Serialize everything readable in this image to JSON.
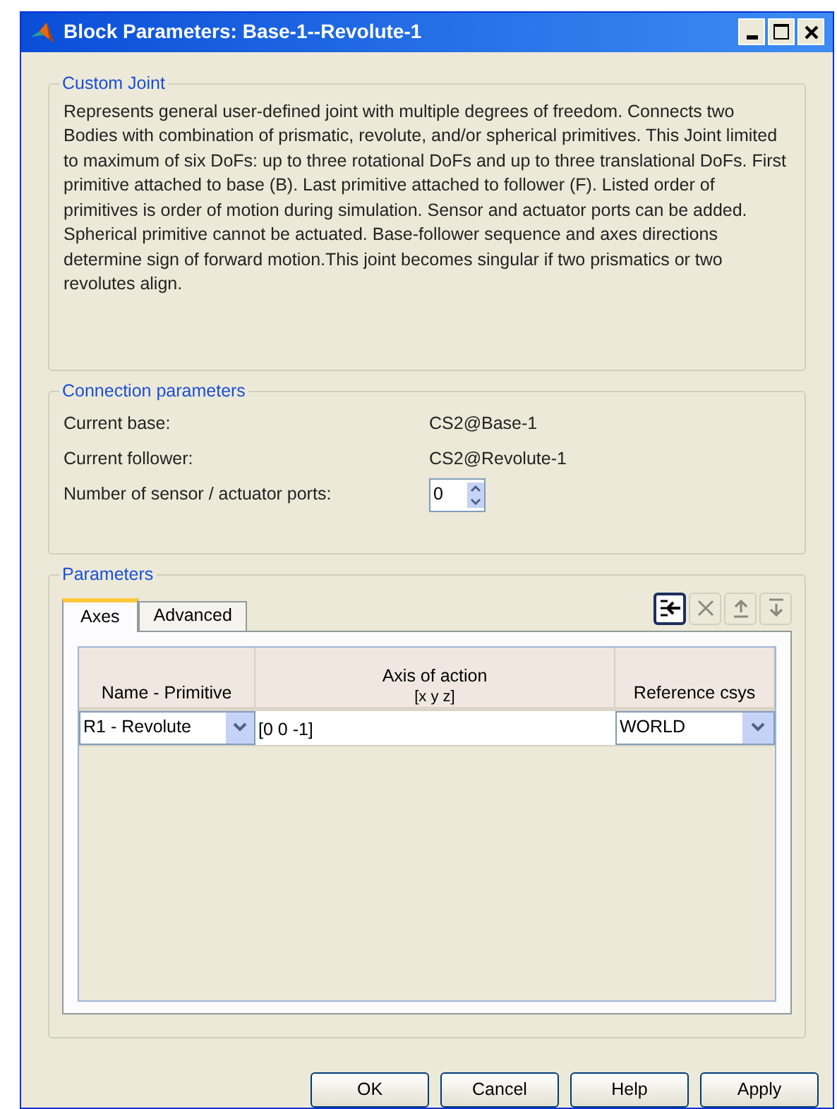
{
  "window": {
    "title": "Block Parameters: Base-1--Revolute-1"
  },
  "custom_joint": {
    "title": "Custom Joint",
    "description": "Represents general user-defined joint with multiple degrees of freedom. Connects two Bodies with combination of prismatic, revolute, and/or spherical primitives. This Joint limited to maximum of six DoFs: up to three rotational DoFs and up to three translational DoFs. First primitive attached to base (B). Last primitive attached to follower (F). Listed order of primitives is order of motion during simulation. Sensor and actuator ports can be added. Spherical primitive cannot be actuated. Base-follower sequence and axes directions determine sign of forward motion.This joint becomes singular if two prismatics or two revolutes align."
  },
  "connection_parameters": {
    "title": "Connection parameters",
    "rows": [
      {
        "kind": "text",
        "label": "Current base:",
        "value": "CS2@Base-1"
      },
      {
        "kind": "text",
        "label": "Current follower:",
        "value": "CS2@Revolute-1"
      },
      {
        "kind": "spinner",
        "label": "Number of sensor / actuator ports:",
        "value": "0"
      }
    ]
  },
  "parameters": {
    "title": "Parameters",
    "tabs": [
      {
        "label": "Axes",
        "selected": true
      },
      {
        "label": "Advanced",
        "selected": false
      }
    ],
    "toolbar": [
      {
        "kind": "insert",
        "disabled": false
      },
      {
        "kind": "delete",
        "disabled": true
      },
      {
        "kind": "up",
        "disabled": true
      },
      {
        "kind": "down",
        "disabled": true
      }
    ],
    "table": {
      "columns": [
        [
          "Name - Primitive"
        ],
        [
          "Axis of action",
          "[x y z]"
        ],
        [
          "Reference csys"
        ]
      ],
      "rows": [
        {
          "primitive": "R1 - Revolute",
          "axis": "[0 0 -1]",
          "csys": "WORLD"
        }
      ]
    }
  },
  "buttons": [
    "OK",
    "Cancel",
    "Help",
    "Apply"
  ]
}
